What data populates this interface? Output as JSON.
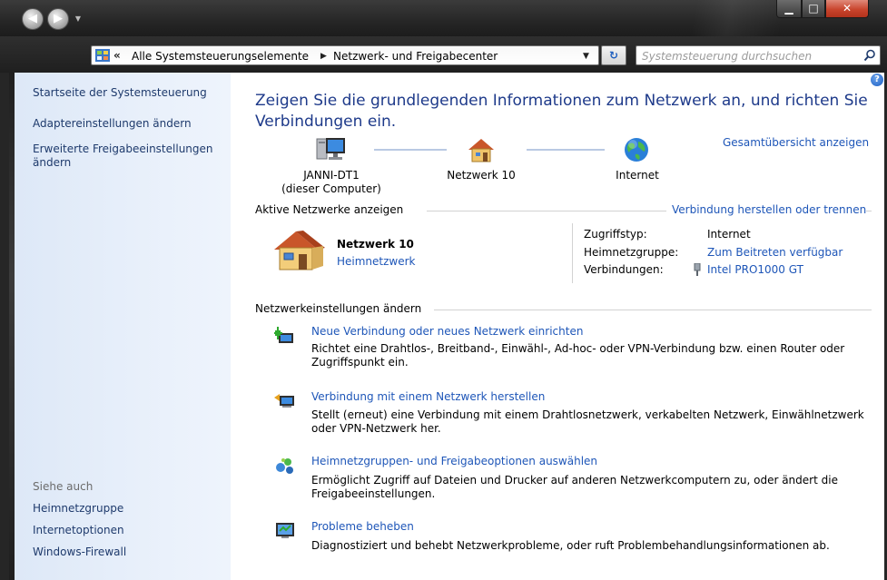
{
  "window": {
    "minimize_glyph": "▁",
    "maximize_glyph": "□",
    "close_glyph": "✕"
  },
  "nav": {
    "back_glyph": "◀",
    "forward_glyph": "▶",
    "dropdown_glyph": "▼"
  },
  "address": {
    "chevron": "«",
    "crumbs": [
      "Alle Systemsteuerungselemente",
      "Netzwerk- und Freigabecenter"
    ],
    "separator": "▶",
    "dropdown_glyph": "▼",
    "refresh_glyph": "↻"
  },
  "search": {
    "placeholder": "Systemsteuerung durchsuchen",
    "icon": "search-icon"
  },
  "sidebar": {
    "home": "Startseite der Systemsteuerung",
    "adapter": "Adaptereinstellungen ändern",
    "advanced": "Erweiterte Freigabeeinstellungen ändern",
    "see_also_header": "Siehe auch",
    "see_also": [
      "Heimnetzgruppe",
      "Internetoptionen",
      "Windows-Firewall"
    ]
  },
  "main": {
    "help_glyph": "?",
    "title": "Zeigen Sie die grundlegenden Informationen zum Netzwerk an, und richten Sie Verbindungen ein.",
    "map": {
      "computer_label": "JANNI-DT1\n(dieser Computer)",
      "network_label": "Netzwerk 10",
      "internet_label": "Internet",
      "overview_link": "Gesamtübersicht anzeigen"
    },
    "active": {
      "header": "Aktive Netzwerke anzeigen",
      "connect_link": "Verbindung herstellen oder trennen",
      "network_name": "Netzwerk 10",
      "network_type": "Heimnetzwerk",
      "access_key": "Zugriffstyp:",
      "access_value": "Internet",
      "homegroup_key": "Heimnetzgruppe:",
      "homegroup_value": "Zum Beitreten verfügbar",
      "connections_key": "Verbindungen:",
      "connections_value": "Intel PRO1000 GT"
    },
    "settings": {
      "header": "Netzwerkeinstellungen ändern",
      "tasks": [
        {
          "link": "Neue Verbindung oder neues Netzwerk einrichten",
          "desc": "Richtet eine Drahtlos-, Breitband-, Einwähl-, Ad-hoc- oder VPN-Verbindung bzw. einen Router oder Zugriffspunkt ein."
        },
        {
          "link": "Verbindung mit einem Netzwerk herstellen",
          "desc": "Stellt (erneut) eine Verbindung mit einem Drahtlosnetzwerk, verkabelten Netzwerk, Einwählnetzwerk oder VPN-Netzwerk her."
        },
        {
          "link": "Heimnetzgruppen- und Freigabeoptionen auswählen",
          "desc": "Ermöglicht Zugriff auf Dateien und Drucker auf anderen Netzwerkcomputern zu, oder ändert die Freigabeeinstellungen."
        },
        {
          "link": "Probleme beheben",
          "desc": "Diagnostiziert und behebt Netzwerkprobleme, oder ruft Problembehandlungsinformationen ab."
        }
      ]
    }
  }
}
